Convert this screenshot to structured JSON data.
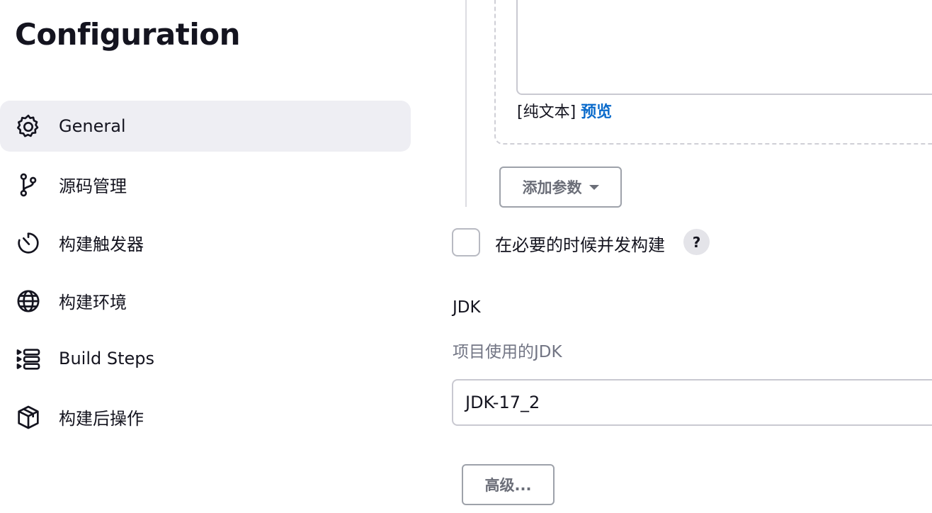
{
  "page_title": "Configuration",
  "sidebar": {
    "items": [
      {
        "label": "General",
        "icon": "gear-icon",
        "active": true
      },
      {
        "label": "源码管理",
        "icon": "git-branch-icon",
        "active": false
      },
      {
        "label": "构建触发器",
        "icon": "timer-icon",
        "active": false
      },
      {
        "label": "构建环境",
        "icon": "globe-icon",
        "active": false
      },
      {
        "label": "Build Steps",
        "icon": "list-steps-icon",
        "active": false
      },
      {
        "label": "构建后操作",
        "icon": "package-icon",
        "active": false
      }
    ]
  },
  "parameters": {
    "text_format_prefix": "[纯文本]",
    "preview_link": "预览",
    "add_param_button": "添加参数"
  },
  "concurrent_build": {
    "label": "在必要的时候并发构建",
    "checked": false,
    "help": "?"
  },
  "jdk": {
    "label": "JDK",
    "description": "项目使用的JDK",
    "selected": "JDK-17_2"
  },
  "advanced_button": "高级...",
  "colors": {
    "active_nav_bg": "#eeeef3",
    "link": "#0b6bcb",
    "muted_text": "#727584",
    "button_border": "#9ea2aa"
  }
}
